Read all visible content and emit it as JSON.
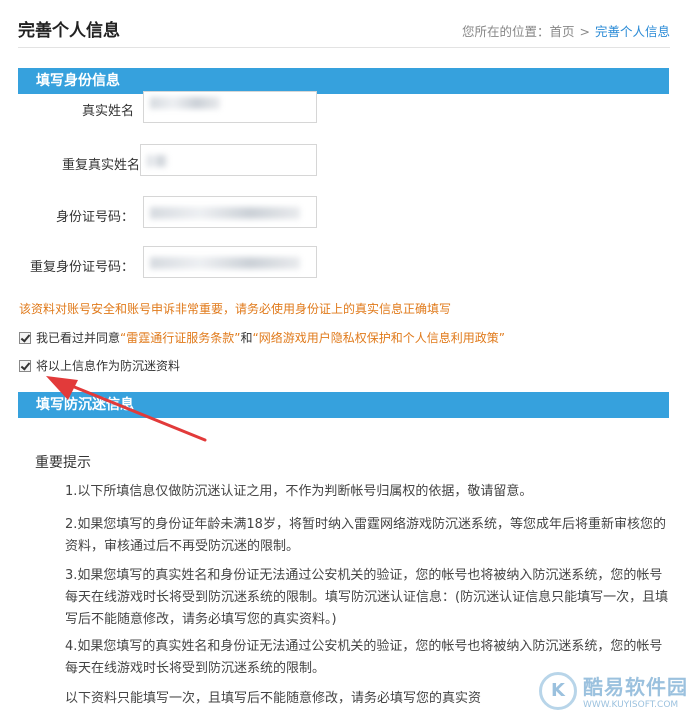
{
  "header": {
    "title": "完善个人信息",
    "breadcrumb_prefix": "您所在的位置：",
    "breadcrumb_home": "首页",
    "breadcrumb_sep": ">",
    "breadcrumb_current": "完善个人信息"
  },
  "section1": {
    "title": "填写身份信息",
    "fields": [
      {
        "label": "真实姓名"
      },
      {
        "label": "重复真实姓名"
      },
      {
        "label": "身份证号码："
      },
      {
        "label": "重复身份证号码："
      }
    ]
  },
  "warning": "该资料对账号安全和账号申诉非常重要，请务必使用身份证上的真实信息正确填写",
  "agree": {
    "prefix": "我已看过并同意",
    "quote_open": "“",
    "link1": "雷霆通行证服务条款",
    "quote_close": "”",
    "and": "和",
    "link2": "网络游戏用户隐私权保护和个人信息利用政策"
  },
  "anti_addiction_check": "将以上信息作为防沉迷资料",
  "section2": {
    "title": "填写防沉迷信息"
  },
  "tips": {
    "title": "重要提示",
    "items": [
      "1.以下所填信息仅做防沉迷认证之用，不作为判断帐号归属权的依据，敬请留意。",
      "2.如果您填写的身份证年龄未满18岁，将暂时纳入雷霆网络游戏防沉迷系统，等您成年后将重新审核您的资料，审核通过后不再受防沉迷的限制。",
      "3.如果您填写的真实姓名和身份证无法通过公安机关的验证，您的帐号也将被纳入防沉迷系统，您的帐号每天在线游戏时长将受到防沉迷系统的限制。填写防沉迷认证信息：(防沉迷认证信息只能填写一次，且填写后不能随意修改，请务必填写您的真实资料。)",
      "4.如果您填写的真实姓名和身份证无法通过公安机关的验证，您的帐号也将被纳入防沉迷系统，您的帐号每天在线游戏时长将受到防沉迷系统的限制。",
      "以下资料只能填写一次，且填写后不能随意修改，请务必填写您的真实资"
    ]
  },
  "watermark": {
    "logo_letter": "K",
    "cn": "酷易软件园",
    "en": "WWW.KUYISOFT.COM"
  },
  "colors": {
    "section_bar": "#36a1dd",
    "link": "#e07a1b",
    "breadcrumb_current": "#2b8bd6",
    "arrow": "#e23a3a"
  }
}
